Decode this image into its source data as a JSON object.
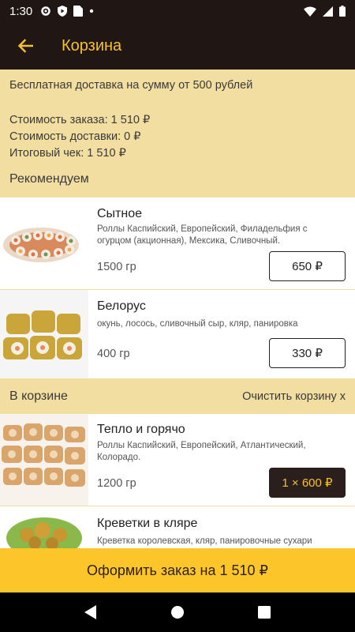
{
  "status": {
    "time": "1:30"
  },
  "app_bar": {
    "title": "Корзина"
  },
  "info": {
    "free_delivery": "Бесплатная доставка на сумму от 500 рублей",
    "order_cost": "Стоимость заказа: 1 510 ₽",
    "delivery_cost": "Стоимость доставки: 0 ₽",
    "total": "Итоговый чек: 1 510 ₽"
  },
  "recommend": {
    "heading": "Рекомендуем",
    "items": [
      {
        "title": "Сытное",
        "desc": "Роллы Каспийский, Европейский, Филадельфия с огурцом (акционная), Мексика, Сливочный.",
        "weight": "1500 гр",
        "price": "650 ₽"
      },
      {
        "title": "Белорус",
        "desc": "окунь, лосось, сливочный сыр, кляр, панировка",
        "weight": "400 гр",
        "price": "330 ₽"
      }
    ]
  },
  "cart": {
    "heading": "В корзине",
    "clear": "Очистить корзину x",
    "items": [
      {
        "title": "Тепло и горячо",
        "desc": "Роллы Каспийский, Европейский, Атлантический, Колорадо.",
        "weight": "1200 гр",
        "price": "1 × 600 ₽"
      },
      {
        "title": "Креветки в кляре",
        "desc": "Креветка королевская, кляр, панировочные сухари"
      }
    ]
  },
  "checkout": {
    "label": "Оформить заказ на 1 510 ₽"
  }
}
